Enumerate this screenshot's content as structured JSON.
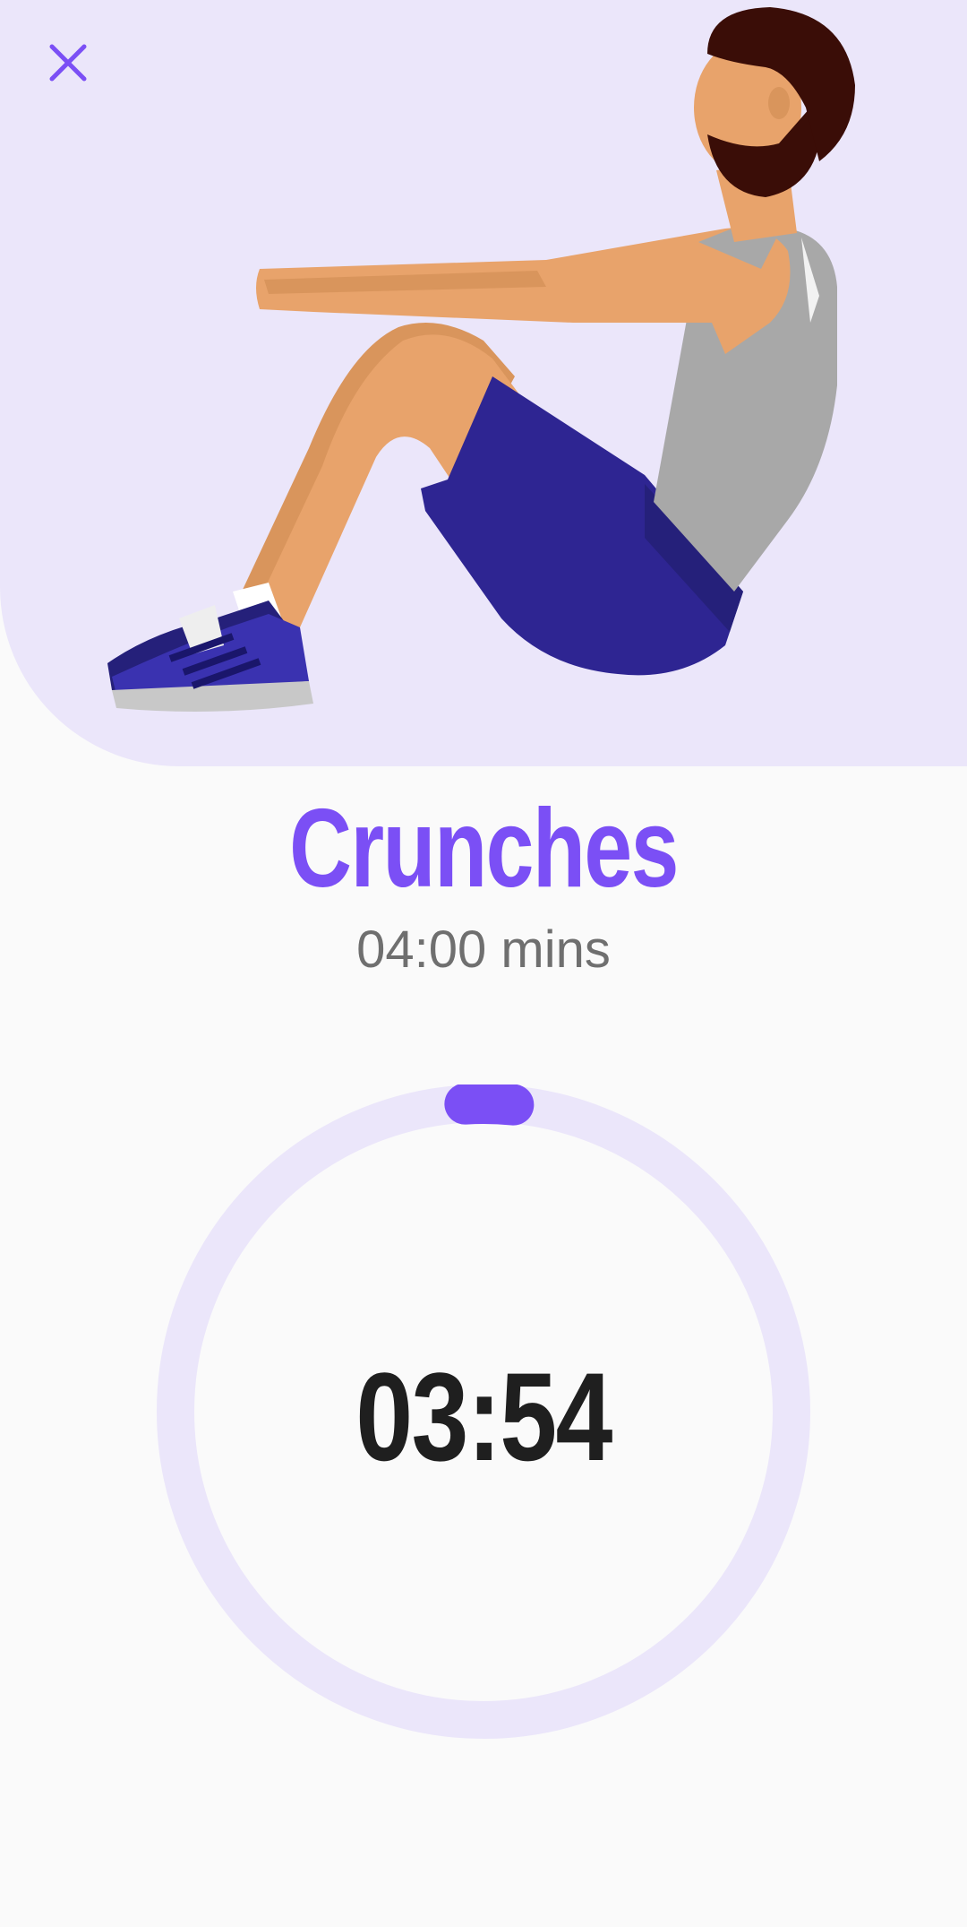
{
  "exercise": {
    "name": "Crunches",
    "duration": "04:00 mins"
  },
  "timer": {
    "remaining": "03:54",
    "elapsed_fraction": 0.025
  },
  "colors": {
    "accent": "#7b4ff5",
    "hero_background": "#ebe6fa",
    "ring_track": "#ebe6fa",
    "page_background": "#fafafa"
  },
  "icons": {
    "close": "close-icon"
  }
}
